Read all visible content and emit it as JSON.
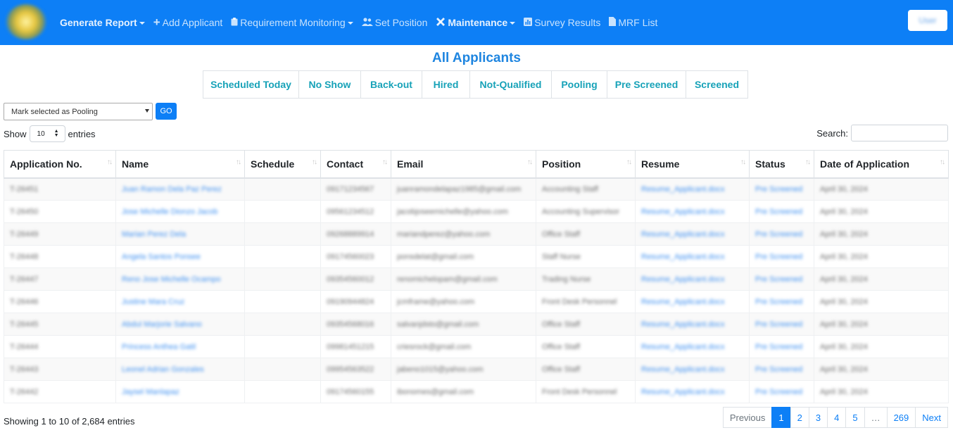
{
  "navbar": {
    "items": [
      {
        "label": "Generate Report",
        "icon": "",
        "dropdown": true,
        "bold": true
      },
      {
        "label": "Add Applicant",
        "icon": "plus-icon",
        "dropdown": false,
        "bold": false
      },
      {
        "label": "Requirement Monitoring",
        "icon": "clipboard-icon",
        "dropdown": true,
        "bold": false
      },
      {
        "label": "Set Position",
        "icon": "users-icon",
        "dropdown": false,
        "bold": false
      },
      {
        "label": "Maintenance",
        "icon": "tools-icon",
        "dropdown": true,
        "bold": true
      },
      {
        "label": "Survey Results",
        "icon": "chart-icon",
        "dropdown": false,
        "bold": false
      },
      {
        "label": "MRF List",
        "icon": "file-icon",
        "dropdown": false,
        "bold": false
      }
    ],
    "user_label": "User",
    "accent_color": "#0d7ff6"
  },
  "page_title": "All Applicants",
  "tabs": [
    "Scheduled Today",
    "No Show",
    "Back-out",
    "Hired",
    "Not-Qualified",
    "Pooling",
    "Pre Screened",
    "Screened"
  ],
  "bulk_action": {
    "selected": "Mark selected as Pooling",
    "go_label": "GO"
  },
  "length": {
    "show": "Show",
    "value": "10",
    "entries": "entries"
  },
  "search": {
    "label": "Search:",
    "value": ""
  },
  "table": {
    "columns": [
      "Application No.",
      "Name",
      "Schedule",
      "Contact",
      "Email",
      "Position",
      "Resume",
      "Status",
      "Date of Application"
    ],
    "rows": [
      [
        "T-26451",
        "Juan Ramon Dela Paz Perez",
        "",
        "09171234567",
        "juanramondelapaz1985@gmail.com",
        "Accounting Staff",
        "Resume_Applicant.docx",
        "Pre Screened",
        "April 30, 2024"
      ],
      [
        "T-26450",
        "Jose Michelle Dionzo Jacob",
        "",
        "09561234512",
        "jacobjoseemichelle@yahoo.com",
        "Accounting Supervisor",
        "Resume_Applicant.docx",
        "Pre Screened",
        "April 30, 2024"
      ],
      [
        "T-26449",
        "Marian Perez Dela",
        "",
        "09268889914",
        "mariandperez@yahoo.com",
        "Office Staff",
        "Resume_Applicant.docx",
        "Pre Screened",
        "April 30, 2024"
      ],
      [
        "T-26448",
        "Angela Santos Ponsee",
        "",
        "09174560023",
        "ponsdelat@gmail.com",
        "Staff Nurse",
        "Resume_Applicant.docx",
        "Pre Screened",
        "April 30, 2024"
      ],
      [
        "T-26447",
        "Reno Jose Michelle Ocampo",
        "",
        "09354560012",
        "renomichelopam@gmail.com",
        "Trading Nurse",
        "Resume_Applicant.docx",
        "Pre Screened",
        "April 30, 2024"
      ],
      [
        "T-26446",
        "Justine Mara Cruz",
        "",
        "09190944824",
        "jcmframe@yahoo.com",
        "Front Desk Personnel",
        "Resume_Applicant.docx",
        "Pre Screened",
        "April 30, 2024"
      ],
      [
        "T-26445",
        "Abdul Marjorie Salvano",
        "",
        "09354568016",
        "salvanjdsto@gmail.com",
        "Office Staff",
        "Resume_Applicant.docx",
        "Pre Screened",
        "April 30, 2024"
      ],
      [
        "T-26444",
        "Princess Anthea Gatil",
        "",
        "09981451215",
        "criesrock@gmail.com",
        "Office Staff",
        "Resume_Applicant.docx",
        "Pre Screened",
        "April 30, 2024"
      ],
      [
        "T-26443",
        "Leonel Adrian Gonzales",
        "",
        "09954563522",
        "jabeno1015@yahoo.com",
        "Office Staff",
        "Resume_Applicant.docx",
        "Pre Screened",
        "April 30, 2024"
      ],
      [
        "T-26442",
        "Jaysel Manlapaz",
        "",
        "09174560155",
        "ibonomes@gmail.com",
        "Front Desk Personnel",
        "Resume_Applicant.docx",
        "Pre Screened",
        "April 30, 2024"
      ]
    ]
  },
  "footer": {
    "info": "Showing 1 to 10 of 2,684 entries",
    "pages": [
      "Previous",
      "1",
      "2",
      "3",
      "4",
      "5",
      "…",
      "269",
      "Next"
    ],
    "active_page": "1"
  }
}
